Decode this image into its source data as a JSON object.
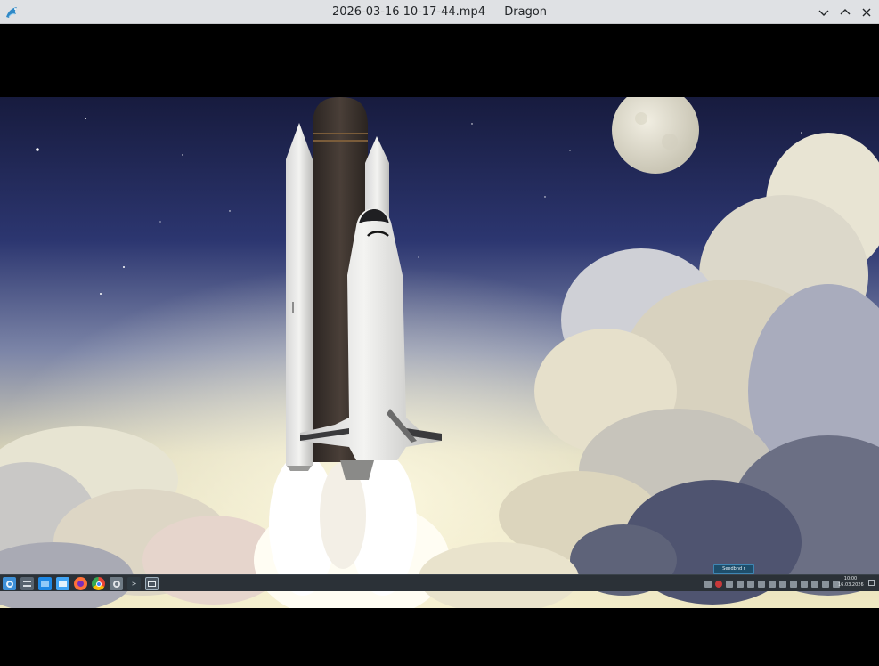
{
  "window": {
    "title": "2026-03-16 10-17-44.mp4 — Dragon",
    "app_icon": "dragon-player-icon",
    "controls": [
      {
        "name": "minimize-button",
        "icon": "chevron-down-icon"
      },
      {
        "name": "maximize-button",
        "icon": "chevron-up-icon"
      },
      {
        "name": "close-button",
        "icon": "close-icon"
      }
    ]
  },
  "video": {
    "scene": "space-shuttle-launch-illustration"
  },
  "taskbar": {
    "launchers": [
      {
        "name": "app-launcher",
        "icon": "plasma-launcher-icon",
        "color": "#3d8fd6"
      },
      {
        "name": "task-switcher",
        "icon": "windows-overview-icon",
        "color": "#586470"
      },
      {
        "name": "dolphin",
        "icon": "folder-icon",
        "color": "#1e88e5"
      },
      {
        "name": "files",
        "icon": "folder-open-icon",
        "color": "#42a5f5"
      },
      {
        "name": "firefox",
        "icon": "firefox-icon",
        "color": "#ff7139"
      },
      {
        "name": "chrome",
        "icon": "chrome-icon",
        "color": "#34a853"
      },
      {
        "name": "settings",
        "icon": "system-settings-icon",
        "color": "#6f7b85"
      },
      {
        "name": "terminal",
        "icon": "terminal-icon",
        "color": "#2f3a42"
      },
      {
        "name": "screen-recorder",
        "icon": "screen-record-icon",
        "color": "#4a5560"
      }
    ],
    "tooltip": "Seedbnd r",
    "clock_time": "10:00",
    "clock_date": "16.03.2026"
  },
  "colors": {
    "titlebar_bg": "#dfe1e4",
    "taskbar_bg": "#2b3137",
    "sky_top": "#161a3a",
    "sky_bottom": "#dfd9b8"
  }
}
